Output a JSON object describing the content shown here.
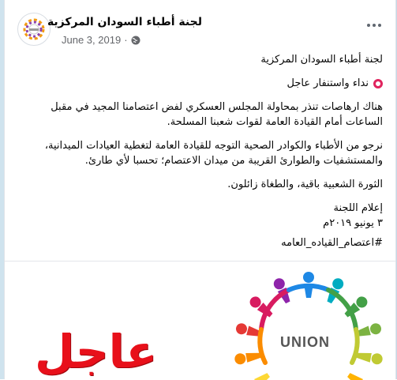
{
  "post": {
    "page_name": "لجنة أطباء السودان المركزية",
    "date": "June 3, 2019",
    "separator": "·",
    "more_icon": "more-horizontal-icon",
    "privacy_icon": "globe-icon",
    "lines": {
      "heading": "لجنة أطباء السودان المركزية",
      "alert": "نداء واستنفار عاجل",
      "paragraph1": "هناك ارهاصات تنذر بمحاولة المجلس العسكري لفض اعتصامنا المجيد في مقبل الساعات أمام القيادة العامة لقوات شعبنا المسلحة.",
      "paragraph2": "نرجو من الأطباء والكوادر الصحية التوجه للقيادة العامة لتغطية العيادات الميدانية، والمستشفيات والطوارئ القريبة من ميدان الاعتصام؛ تحسبا لأي طارئ.",
      "paragraph3": "الثورة الشعبية باقية، والطغاة زائلون.",
      "signature": "إعلام اللجنة",
      "sign_date": "٣ يونيو ٢٠١٩م",
      "hashtag": "#اعتصام_القياده_العامه"
    }
  },
  "media": {
    "urgent_text": "عاجل",
    "logo_text": "UNION"
  },
  "colors": {
    "accent_red": "#e8101a",
    "meta_gray": "#65676b"
  }
}
